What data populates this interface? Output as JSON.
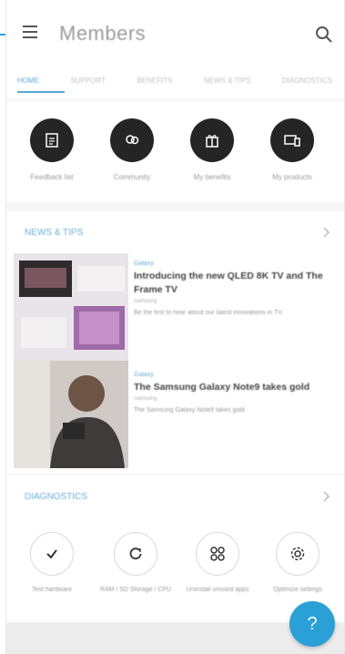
{
  "header": {
    "title": "Members",
    "menu_icon": "hamburger-icon",
    "search_icon": "search-icon"
  },
  "tabs": [
    {
      "label": "Home",
      "active": true
    },
    {
      "label": "Support",
      "active": false
    },
    {
      "label": "Benefits",
      "active": false
    },
    {
      "label": "News & Tips",
      "active": false
    },
    {
      "label": "Diagnostics",
      "active": false
    }
  ],
  "quick_actions": [
    {
      "label": "Feedback list",
      "icon": "document-icon"
    },
    {
      "label": "Community",
      "icon": "community-icon"
    },
    {
      "label": "My benefits",
      "icon": "gift-icon"
    },
    {
      "label": "My products",
      "icon": "devices-icon"
    }
  ],
  "news_tips": {
    "title": "News & Tips",
    "items": [
      {
        "category": "Galaxy",
        "headline": "Introducing the new QLED 8K TV and The Frame TV",
        "meta": "Samsung",
        "description": "Be the first to hear about our latest innovations in TV."
      },
      {
        "category": "Galaxy",
        "headline": "The Samsung Galaxy Note9 takes gold",
        "meta": "Samsung",
        "description": "The Samsung Galaxy Note9 takes gold"
      }
    ]
  },
  "diagnostics": {
    "title": "Diagnostics",
    "items": [
      {
        "label": "Test hardware",
        "icon": "checkmark-icon"
      },
      {
        "label": "RAM / SD Storage / CPU",
        "icon": "refresh-icon"
      },
      {
        "label": "Uninstall unused apps",
        "icon": "apps-grid-icon"
      },
      {
        "label": "Optimize settings",
        "icon": "gear-icon"
      }
    ]
  },
  "help_button": {
    "label": "?"
  },
  "colors": {
    "accent": "#2aa0d6",
    "action_circle": "#252525"
  }
}
